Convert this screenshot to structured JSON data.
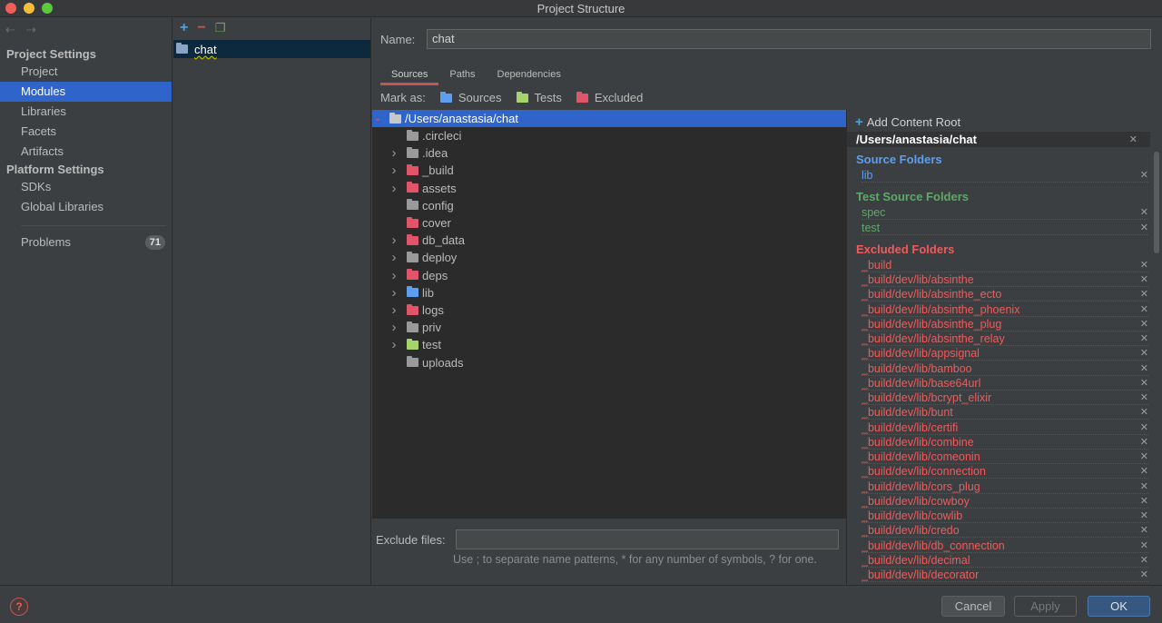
{
  "window": {
    "title": "Project Structure"
  },
  "nav": {
    "project_settings": "Project Settings",
    "project_items": [
      "Project",
      "Modules",
      "Libraries",
      "Facets",
      "Artifacts"
    ],
    "platform_settings": "Platform Settings",
    "platform_items": [
      "SDKs",
      "Global Libraries"
    ],
    "problems": {
      "label": "Problems",
      "count": "71"
    }
  },
  "modules": {
    "items": [
      "chat"
    ]
  },
  "module": {
    "name_label": "Name:",
    "name_value": "chat",
    "tabs": [
      "Sources",
      "Paths",
      "Dependencies"
    ],
    "mark_as": {
      "label": "Mark as:",
      "sources": "Sources",
      "tests": "Tests",
      "excluded": "Excluded"
    },
    "tree": {
      "root": "/Users/anastasia/chat",
      "children": [
        {
          "name": ".circleci",
          "kind": "plain",
          "expandable": false
        },
        {
          "name": ".idea",
          "kind": "plain",
          "expandable": true
        },
        {
          "name": "_build",
          "kind": "excluded",
          "expandable": true
        },
        {
          "name": "assets",
          "kind": "excluded",
          "expandable": true
        },
        {
          "name": "config",
          "kind": "plain",
          "expandable": false
        },
        {
          "name": "cover",
          "kind": "excluded",
          "expandable": false
        },
        {
          "name": "db_data",
          "kind": "excluded",
          "expandable": true
        },
        {
          "name": "deploy",
          "kind": "plain",
          "expandable": true
        },
        {
          "name": "deps",
          "kind": "excluded",
          "expandable": true
        },
        {
          "name": "lib",
          "kind": "source",
          "expandable": true
        },
        {
          "name": "logs",
          "kind": "excluded",
          "expandable": true
        },
        {
          "name": "priv",
          "kind": "plain",
          "expandable": true
        },
        {
          "name": "test",
          "kind": "test",
          "expandable": true
        },
        {
          "name": "uploads",
          "kind": "plain",
          "expandable": false
        }
      ]
    },
    "exclude_files": {
      "label": "Exclude files:",
      "value": "",
      "hint": "Use ; to separate name patterns, * for any number of symbols, ? for one."
    }
  },
  "content_root": {
    "add_label": "Add Content Root",
    "path": "/Users/anastasia/chat",
    "source_header": "Source Folders",
    "source_folders": [
      "lib"
    ],
    "test_header": "Test Source Folders",
    "test_folders": [
      "spec",
      "test"
    ],
    "excluded_header": "Excluded Folders",
    "excluded_folders": [
      "_build",
      "_build/dev/lib/absinthe",
      "_build/dev/lib/absinthe_ecto",
      "_build/dev/lib/absinthe_phoenix",
      "_build/dev/lib/absinthe_plug",
      "_build/dev/lib/absinthe_relay",
      "_build/dev/lib/appsignal",
      "_build/dev/lib/bamboo",
      "_build/dev/lib/base64url",
      "_build/dev/lib/bcrypt_elixir",
      "_build/dev/lib/bunt",
      "_build/dev/lib/certifi",
      "_build/dev/lib/combine",
      "_build/dev/lib/comeonin",
      "_build/dev/lib/connection",
      "_build/dev/lib/cors_plug",
      "_build/dev/lib/cowboy",
      "_build/dev/lib/cowlib",
      "_build/dev/lib/credo",
      "_build/dev/lib/db_connection",
      "_build/dev/lib/decimal",
      "_build/dev/lib/decorator"
    ]
  },
  "buttons": {
    "cancel": "Cancel",
    "apply": "Apply",
    "ok": "OK"
  },
  "colors": {
    "selection": "#2f65ca",
    "source": "#5c9ff0",
    "test": "#5fa86a",
    "excluded": "#ee5b5b",
    "plain_folder": "#9a9a9a"
  }
}
